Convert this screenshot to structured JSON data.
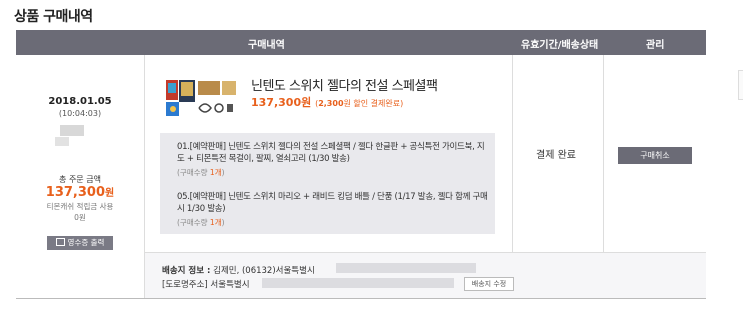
{
  "page": {
    "title": "상품 구매내역"
  },
  "table": {
    "headers": {
      "item": "구매내역",
      "status": "유효기간/배송상태",
      "manage": "관리"
    }
  },
  "order": {
    "date": "2018.01.05",
    "time": "(10:04:03)",
    "total_label": "총 주문 금액",
    "total_amount": "137,300",
    "total_unit": "원",
    "points_label": "티몬캐쉬 적립금 사용",
    "points_value": "0원",
    "receipt_button": "영수증 출력"
  },
  "product": {
    "name": "닌텐도 스위치 젤다의 전설 스페셜팩",
    "price": "137,300원",
    "discount_prefix": "(",
    "discount_amount": "2,300",
    "discount_suffix": "원 할인 결제완료)",
    "options": [
      {
        "text": "01.[예약판매] 닌텐도 스위치 젤다의 전설 스페셜팩 / 젤다 한글판 + 공식특전 가이드북, 지도 + 티몬특전 목걸이, 팔찌, 열쇠고리 (1/30 발송)",
        "qty_prefix": "(구매수량",
        "qty": "1개",
        "qty_suffix": ")"
      },
      {
        "text": "05.[예약판매] 닌텐도 스위치 마리오 + 래비드 킹덤 배틀 / 단품 (1/17 발송, 젤다 함께 구매시 1/30 발송)",
        "qty_prefix": "(구매수량",
        "qty": "1개",
        "qty_suffix": ")"
      }
    ],
    "status": "결제 완료",
    "cancel_button": "구매취소"
  },
  "shipping": {
    "label": "배송지 정보 :",
    "line1_visible": "김제민, (06132)서울특별시",
    "line2_visible": "[도로명주소] 서울특별시",
    "change_button": "배송지 수정"
  },
  "colors": {
    "accent": "#e8601c",
    "header_bg": "#6b6b76"
  }
}
